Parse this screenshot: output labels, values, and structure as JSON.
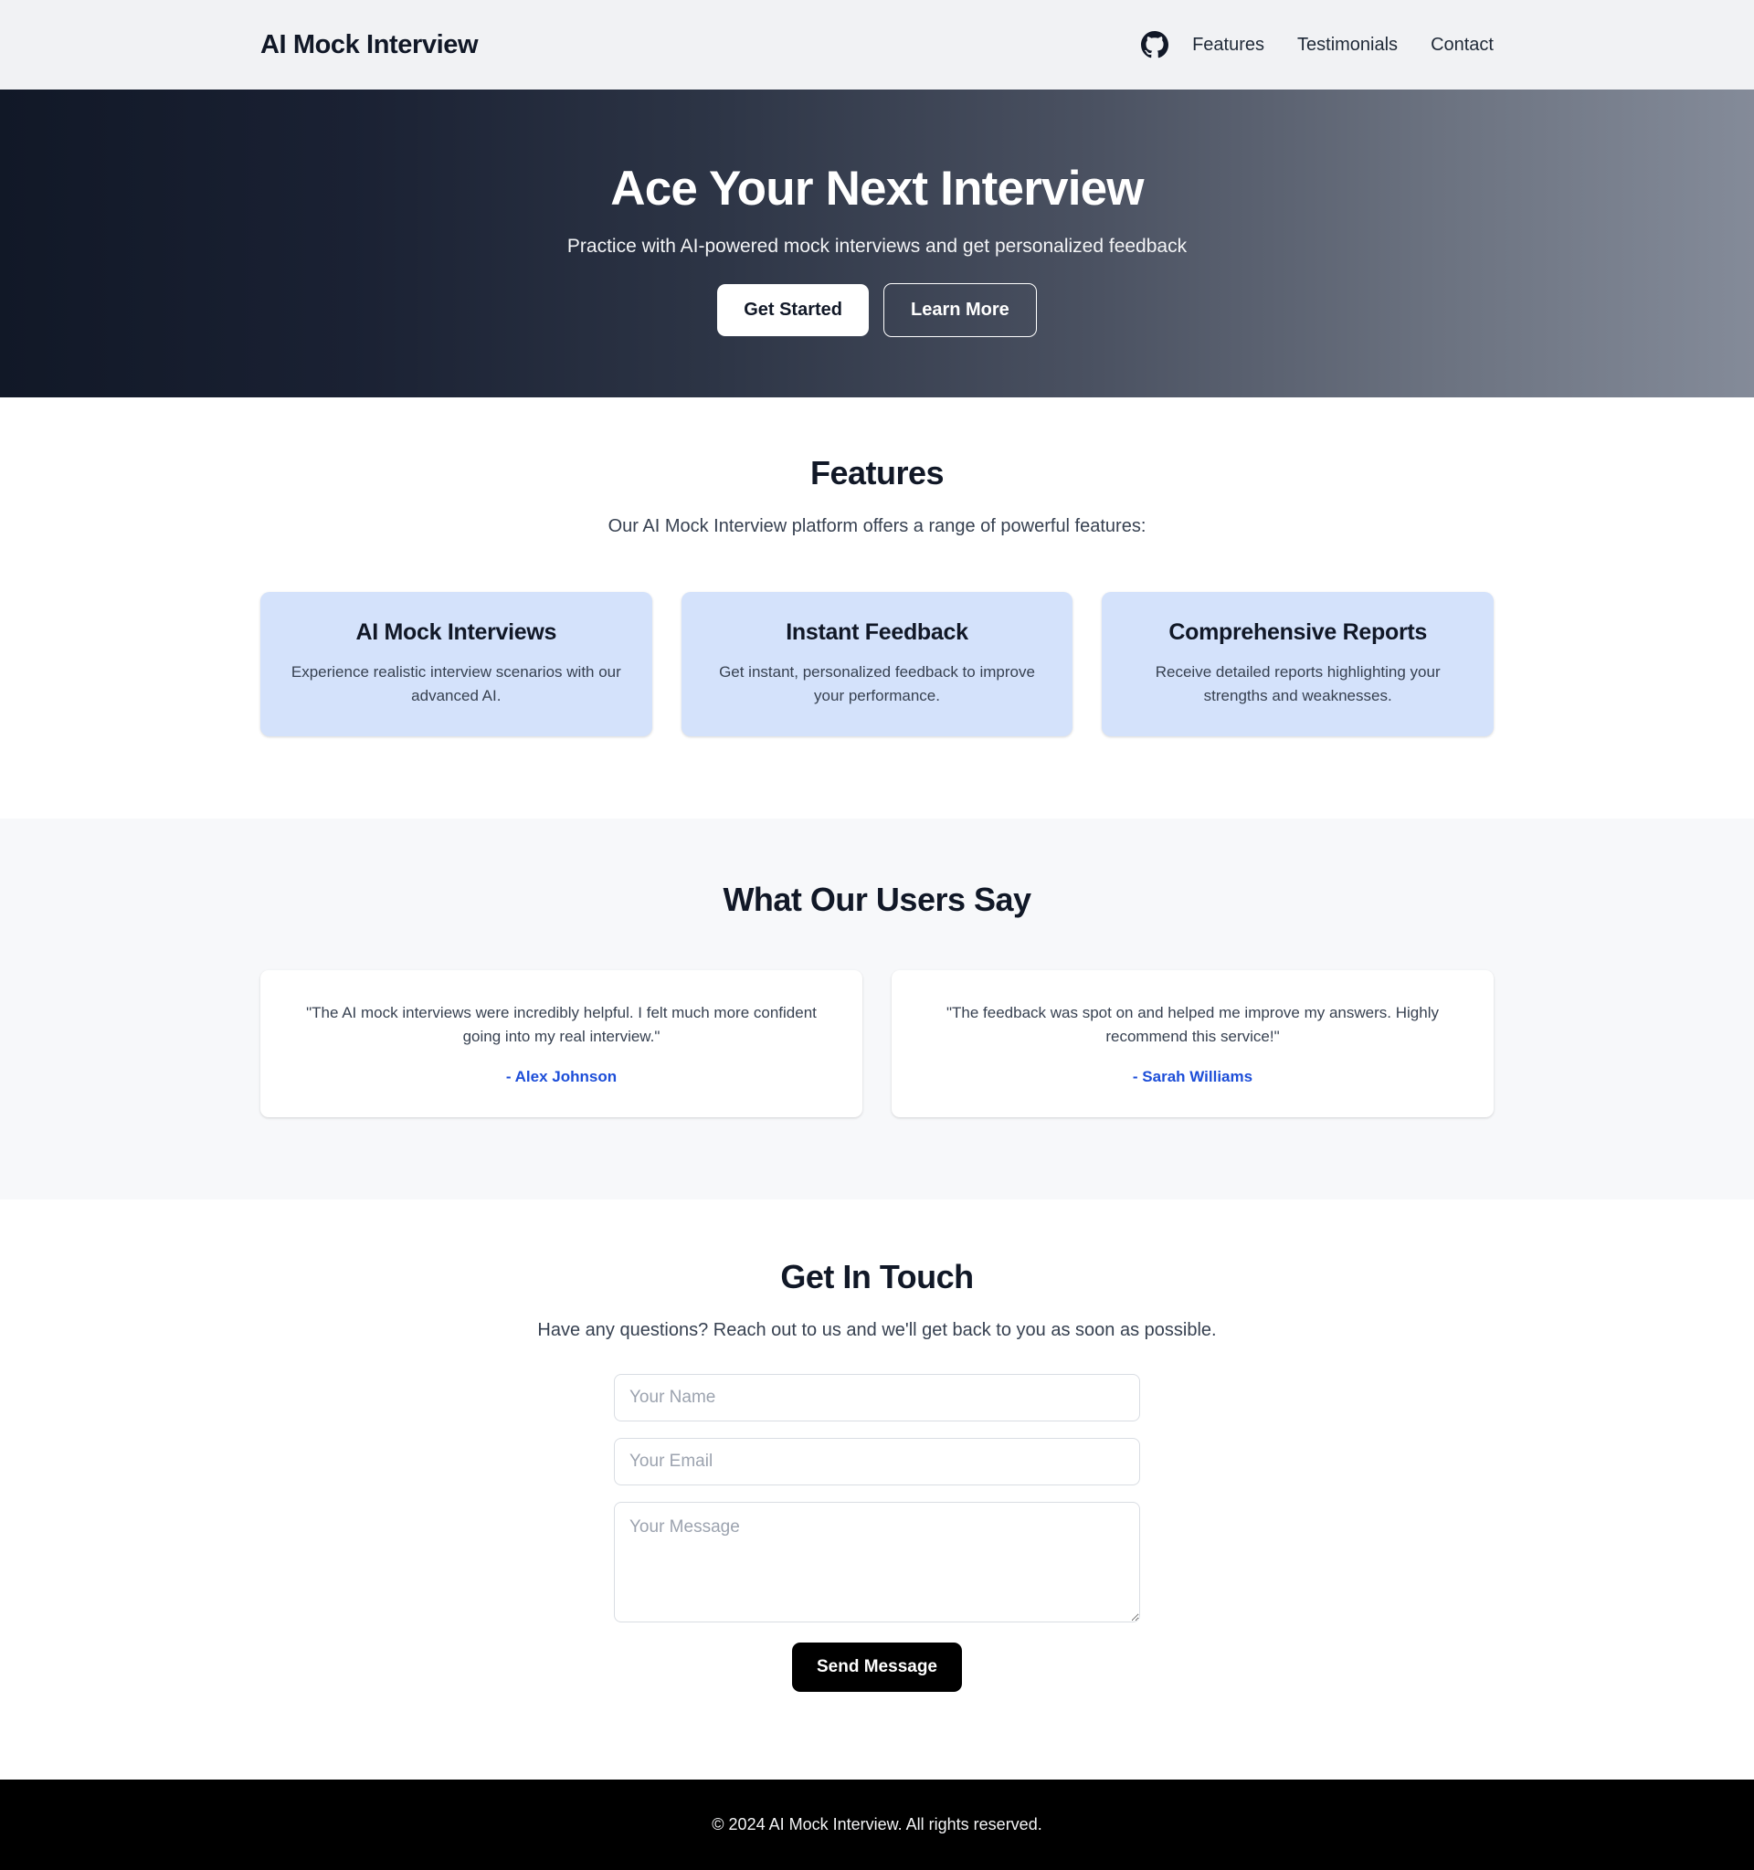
{
  "header": {
    "brand": "AI Mock Interview",
    "github_icon": "github-icon",
    "nav": [
      {
        "label": "Features"
      },
      {
        "label": "Testimonials"
      },
      {
        "label": "Contact"
      }
    ]
  },
  "hero": {
    "title": "Ace Your Next Interview",
    "subtitle": "Practice with AI-powered mock interviews and get personalized feedback",
    "primary_cta": "Get Started",
    "secondary_cta": "Learn More",
    "gradient_from": "#111827",
    "gradient_to": "#848b99"
  },
  "features": {
    "title": "Features",
    "subtitle": "Our AI Mock Interview platform offers a range of powerful features:",
    "card_bg": "#d4e2fb",
    "items": [
      {
        "title": "AI Mock Interviews",
        "body": "Experience realistic interview scenarios with our advanced AI."
      },
      {
        "title": "Instant Feedback",
        "body": "Get instant, personalized feedback to improve your performance."
      },
      {
        "title": "Comprehensive Reports",
        "body": "Receive detailed reports highlighting your strengths and weaknesses."
      }
    ]
  },
  "testimonials": {
    "title": "What Our Users Say",
    "accent": "#1d4ed8",
    "items": [
      {
        "quote": "\"The AI mock interviews were incredibly helpful. I felt much more confident going into my real interview.\"",
        "author": "- Alex Johnson"
      },
      {
        "quote": "\"The feedback was spot on and helped me improve my answers. Highly recommend this service!\"",
        "author": "- Sarah Williams"
      }
    ]
  },
  "contact": {
    "title": "Get In Touch",
    "subtitle": "Have any questions? Reach out to us and we'll get back to you as soon as possible.",
    "name_placeholder": "Your Name",
    "name_value": "",
    "email_placeholder": "Your Email",
    "email_value": "",
    "message_placeholder": "Your Message",
    "message_value": "",
    "submit_label": "Send Message"
  },
  "footer": {
    "copyright": "© 2024 AI Mock Interview. All rights reserved."
  }
}
